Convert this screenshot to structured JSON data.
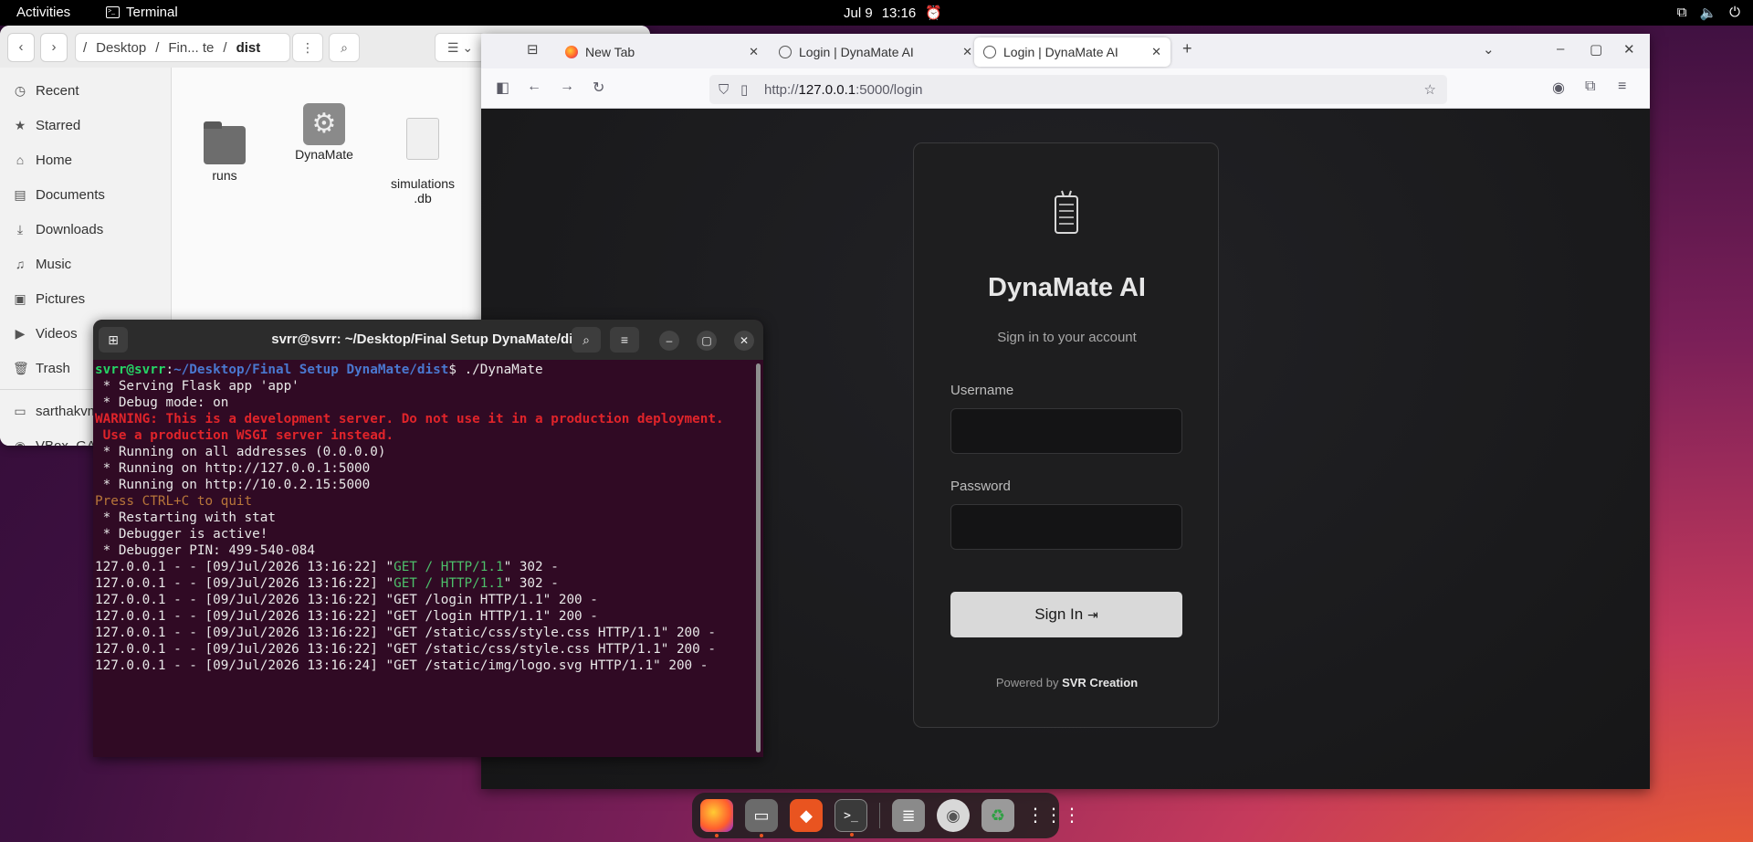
{
  "topbar": {
    "activities": "Activities",
    "app_name": "Terminal",
    "date": "Jul 9",
    "time": "13:16"
  },
  "files": {
    "path": [
      "Desktop",
      "Fin... te",
      "dist"
    ],
    "sidebar": [
      {
        "label": "Recent",
        "icon": "clock-icon"
      },
      {
        "label": "Starred",
        "icon": "star-icon"
      },
      {
        "label": "Home",
        "icon": "home-icon"
      },
      {
        "label": "Documents",
        "icon": "document-icon"
      },
      {
        "label": "Downloads",
        "icon": "download-icon"
      },
      {
        "label": "Music",
        "icon": "music-icon"
      },
      {
        "label": "Pictures",
        "icon": "picture-icon"
      },
      {
        "label": "Videos",
        "icon": "video-icon"
      },
      {
        "label": "Trash",
        "icon": "trash-icon"
      }
    ],
    "devices": [
      "sarthakvm",
      "VBox_GAs"
    ],
    "items": [
      {
        "name": "runs",
        "type": "folder"
      },
      {
        "name": "DynaMate",
        "type": "executable"
      },
      {
        "name": "simulations\n.db",
        "type": "file"
      }
    ]
  },
  "browser": {
    "tabs": [
      {
        "title": "New Tab"
      },
      {
        "title": "Login | DynaMate AI"
      },
      {
        "title": "Login | DynaMate AI"
      }
    ],
    "url_prefix": "http://",
    "url_host": "127.0.0.1",
    "url_rest": ":5000/login"
  },
  "login": {
    "brand": "DynaMate AI",
    "subtitle": "Sign in to your account",
    "username_label": "Username",
    "password_label": "Password",
    "signin_label": "Sign In",
    "powered_prefix": "Powered by",
    "powered_by": "SVR Creation"
  },
  "terminal": {
    "title": "svrr@svrr: ~/Desktop/Final Setup DynaMate/dist",
    "prompt_user": "svrr@svrr",
    "prompt_path": "~/Desktop/Final Setup DynaMate/dist",
    "command": "./DynaMate",
    "lines": [
      " * Serving Flask app 'app'",
      " * Debug mode: on"
    ],
    "warning": [
      "WARNING: This is a development server. Do not use it in a production deployment.",
      " Use a production WSGI server instead."
    ],
    "lines2": [
      " * Running on all addresses (0.0.0.0)",
      " * Running on http://127.0.0.1:5000",
      " * Running on http://10.0.2.15:5000"
    ],
    "quit": "Press CTRL+C to quit",
    "lines3": [
      " * Restarting with stat",
      " * Debugger is active!",
      " * Debugger PIN: 499-540-084"
    ],
    "requests_green": [
      {
        "prefix": "127.0.0.1 - - [09/Jul/2026 13:16:22] \"",
        "req": "GET / HTTP/1.1",
        "suffix": "\" 302 -"
      },
      {
        "prefix": "127.0.0.1 - - [09/Jul/2026 13:16:22] \"",
        "req": "GET / HTTP/1.1",
        "suffix": "\" 302 -"
      }
    ],
    "requests": [
      "127.0.0.1 - - [09/Jul/2026 13:16:22] \"GET /login HTTP/1.1\" 200 -",
      "127.0.0.1 - - [09/Jul/2026 13:16:22] \"GET /login HTTP/1.1\" 200 -",
      "127.0.0.1 - - [09/Jul/2026 13:16:22] \"GET /static/css/style.css HTTP/1.1\" 200 -",
      "127.0.0.1 - - [09/Jul/2026 13:16:22] \"GET /static/css/style.css HTTP/1.1\" 200 -",
      "127.0.0.1 - - [09/Jul/2026 13:16:24] \"GET /static/img/logo.svg HTTP/1.1\" 200 -"
    ]
  },
  "dock": [
    "firefox-icon",
    "files-icon",
    "app-center-icon",
    "terminal-icon",
    "text-editor-icon",
    "disc-icon",
    "trash-icon",
    "app-grid-icon"
  ]
}
